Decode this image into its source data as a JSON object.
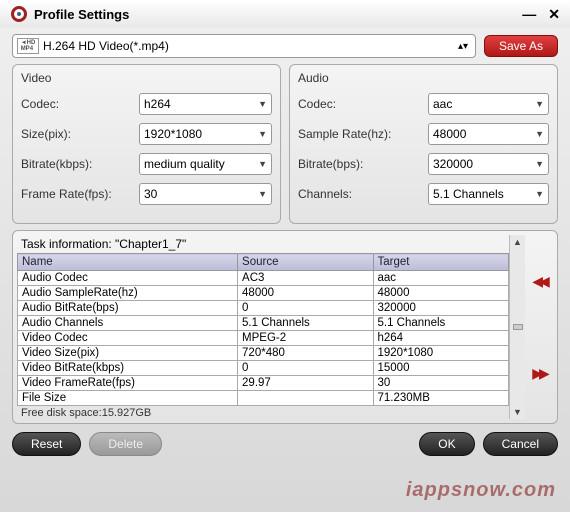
{
  "title": "Profile Settings",
  "profile": {
    "label": "H.264 HD Video(*.mp4)",
    "icon_text": "HD\nMP4"
  },
  "buttons": {
    "save_as": "Save As",
    "reset": "Reset",
    "delete": "Delete",
    "ok": "OK",
    "cancel": "Cancel"
  },
  "video": {
    "section": "Video",
    "codec_label": "Codec:",
    "codec_value": "h264",
    "size_label": "Size(pix):",
    "size_value": "1920*1080",
    "bitrate_label": "Bitrate(kbps):",
    "bitrate_value": "medium quality",
    "framerate_label": "Frame Rate(fps):",
    "framerate_value": "30"
  },
  "audio": {
    "section": "Audio",
    "codec_label": "Codec:",
    "codec_value": "aac",
    "samplerate_label": "Sample Rate(hz):",
    "samplerate_value": "48000",
    "bitrate_label": "Bitrate(bps):",
    "bitrate_value": "320000",
    "channels_label": "Channels:",
    "channels_value": "5.1 Channels"
  },
  "task": {
    "title": "Task information: \"Chapter1_7\"",
    "headers": {
      "name": "Name",
      "source": "Source",
      "target": "Target"
    },
    "rows": [
      {
        "name": "Audio Codec",
        "source": "AC3",
        "target": "aac"
      },
      {
        "name": "Audio SampleRate(hz)",
        "source": "48000",
        "target": "48000"
      },
      {
        "name": "Audio BitRate(bps)",
        "source": "0",
        "target": "320000"
      },
      {
        "name": "Audio Channels",
        "source": "5.1 Channels",
        "target": "5.1 Channels"
      },
      {
        "name": "Video Codec",
        "source": "MPEG-2",
        "target": "h264"
      },
      {
        "name": "Video Size(pix)",
        "source": "720*480",
        "target": "1920*1080"
      },
      {
        "name": "Video BitRate(kbps)",
        "source": "0",
        "target": "15000"
      },
      {
        "name": "Video FrameRate(fps)",
        "source": "29.97",
        "target": "30"
      },
      {
        "name": "File Size",
        "source": "",
        "target": "71.230MB"
      }
    ],
    "free_disk": "Free disk space:15.927GB"
  },
  "watermark": "iappsnow.com"
}
